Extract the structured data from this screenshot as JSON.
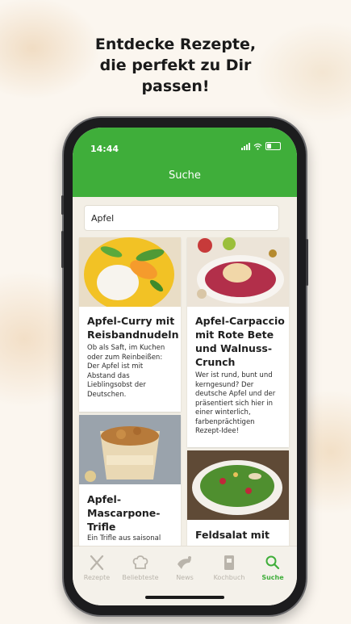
{
  "headline": {
    "line1": "Entdecke Rezepte,",
    "line2": "die perfekt zu Dir",
    "line3": "passen!"
  },
  "status_bar": {
    "time": "14:44"
  },
  "app_bar": {
    "title": "Suche"
  },
  "search": {
    "value": "Apfel"
  },
  "cards": [
    {
      "title_lines": [
        "Apfel-Curry mit",
        "Reisbandnudeln"
      ],
      "desc_lines": [
        "Ob als Saft, im Kuchen",
        "oder zum Reinbeißen:",
        "Der Apfel ist mit",
        "Abstand das",
        "Lieblingsobst der",
        "Deutschen."
      ]
    },
    {
      "title_lines": [
        "Apfel-Carpaccio",
        "mit Rote Bete",
        "und Walnuss-",
        "Crunch"
      ],
      "desc_lines": [
        "Wer ist rund, bunt und",
        "kerngesund? Der",
        "deutsche Apfel und der",
        "präsentiert sich hier in",
        "einer winterlich,",
        "farbenprächtigen",
        "Rezept-Idee!"
      ]
    },
    {
      "title_lines": [
        "Apfel-",
        "Mascarpone-",
        "Trifle"
      ],
      "desc_lines": [
        "Ein Trifle aus saisonal"
      ]
    },
    {
      "title_lines": [
        "Feldsalat mit"
      ],
      "desc_lines": []
    }
  ],
  "tabs": [
    {
      "label": "Rezepte",
      "icon": "cutlery-icon"
    },
    {
      "label": "Beliebteste",
      "icon": "chef-hat-icon"
    },
    {
      "label": "News",
      "icon": "news-icon"
    },
    {
      "label": "Kochbuch",
      "icon": "cookbook-icon"
    },
    {
      "label": "Suche",
      "icon": "search-icon"
    }
  ],
  "colors": {
    "brand_green": "#3fae3a",
    "tab_inactive": "#b9b4ab"
  }
}
